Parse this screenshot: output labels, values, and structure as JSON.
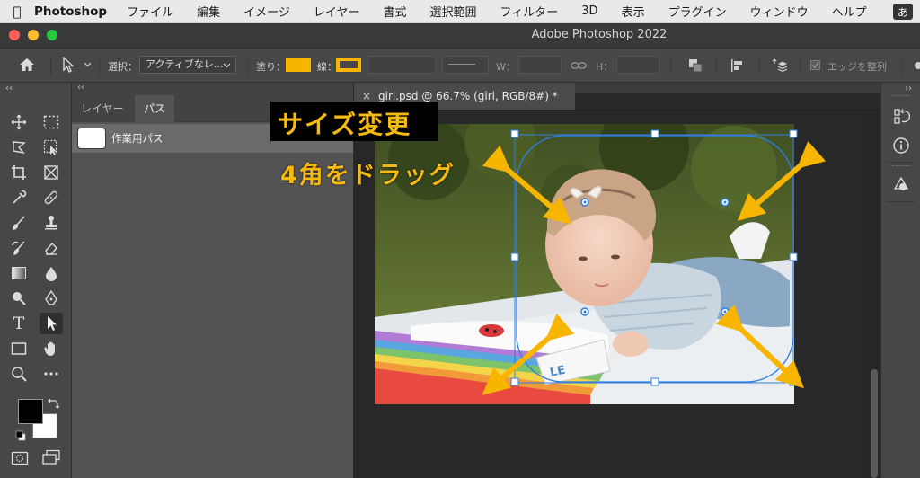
{
  "menubar": {
    "app_name": "Photoshop",
    "items": [
      "ファイル",
      "編集",
      "イメージ",
      "レイヤー",
      "書式",
      "選択範囲",
      "フィルター",
      "3D",
      "表示",
      "プラグイン",
      "ウィンドウ",
      "ヘルプ"
    ],
    "ime_indicator": "あ"
  },
  "window": {
    "title": "Adobe Photoshop 2022"
  },
  "options": {
    "select_label": "選択：",
    "select_value": "アクティブなレ…",
    "fill_label": "塗り：",
    "stroke_label": "線：",
    "w_label": "W：",
    "h_label": "H：",
    "align_edges_label": "エッジを整列",
    "fill_color": "#f7b500"
  },
  "panels": {
    "collapse_left": "‹‹",
    "collapse_mid": "‹‹",
    "tabs": [
      {
        "label": "レイヤー",
        "active": false
      },
      {
        "label": "パス",
        "active": true
      }
    ],
    "path_item": "作業用パス"
  },
  "document": {
    "tab_title": "girl.psd @ 66.7% (girl, RGB/8#) *",
    "close_glyph": "×"
  },
  "annotations": {
    "title": "サイズ変更",
    "instruction": "4角をドラッグ",
    "accent_color": "#f7b500"
  },
  "right_panel": {
    "collapse": "››"
  }
}
